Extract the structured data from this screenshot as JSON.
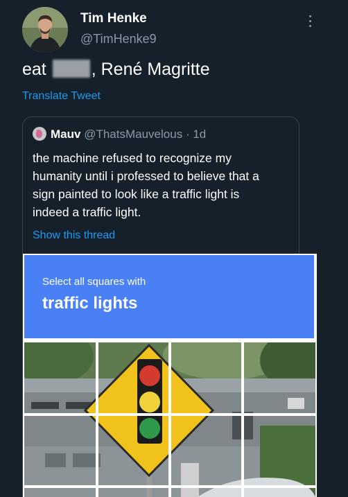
{
  "tweet": {
    "author_name": "Tim Henke",
    "author_handle": "@TimHenke9",
    "text_before": "eat",
    "text_after": ", René Magritte",
    "translate_label": "Translate Tweet"
  },
  "quote": {
    "author_name": "Mauv",
    "author_handle": "@ThatsMauvelous",
    "separator": "·",
    "time": "1d",
    "text_lines": [
      "the machine refused to recognize my",
      "humanity until i professed to believe that a",
      "sign painted to look like a traffic light is",
      "indeed a traffic light."
    ],
    "show_thread_label": "Show this thread"
  },
  "captcha": {
    "instruction": "Select all squares with",
    "target": "traffic lights",
    "header_color": "#4a80f5",
    "sign_color": "#f2c21c",
    "light_colors": [
      "#d23b2e",
      "#f0d23a",
      "#2e9a4a"
    ]
  }
}
